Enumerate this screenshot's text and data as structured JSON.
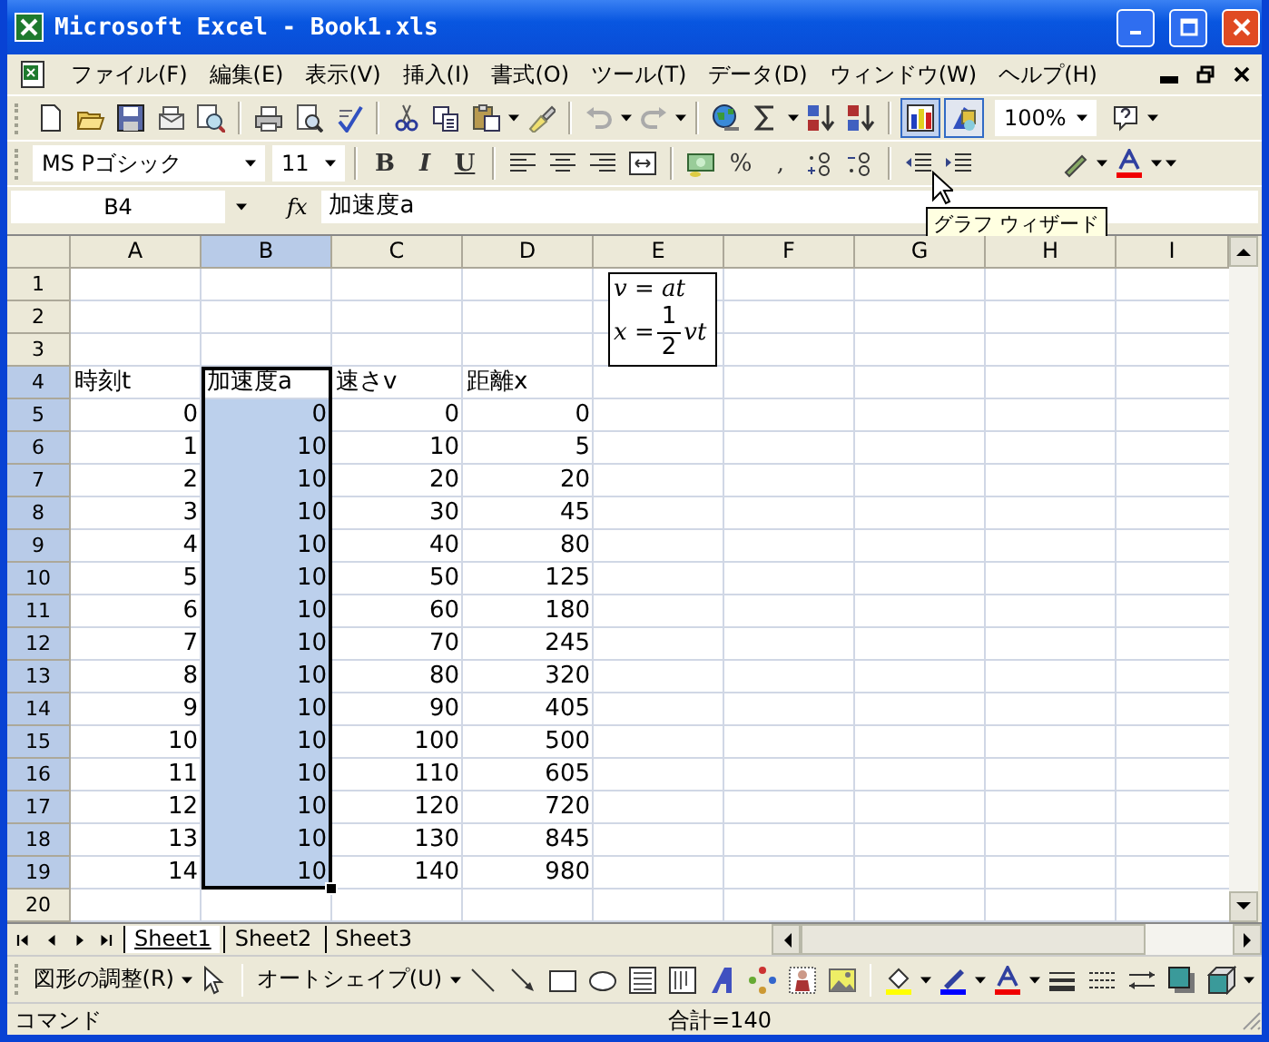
{
  "window": {
    "title": "Microsoft Excel - Book1.xls"
  },
  "menu": [
    "ファイル(F)",
    "編集(E)",
    "表示(V)",
    "挿入(I)",
    "書式(O)",
    "ツール(T)",
    "データ(D)",
    "ウィンドウ(W)",
    "ヘルプ(H)"
  ],
  "standard_toolbar": {
    "chart_wizard_hovered": true,
    "drawing_on": true,
    "zoom": "100%"
  },
  "tooltip": "グラフ ウィザード",
  "formatting_toolbar": {
    "font": "MS Pゴシック",
    "size": "11",
    "style_buttons": [
      "B",
      "I",
      "U"
    ],
    "percent": "%",
    "comma": ","
  },
  "formula_bar": {
    "name_box": "B4",
    "fx": "fx",
    "content": "加速度a"
  },
  "sheet": {
    "columns": [
      {
        "label": "A",
        "selected": false
      },
      {
        "label": "B",
        "selected": true
      },
      {
        "label": "C",
        "selected": false
      },
      {
        "label": "D",
        "selected": false
      },
      {
        "label": "E",
        "selected": false
      },
      {
        "label": "F",
        "selected": false
      },
      {
        "label": "G",
        "selected": false
      },
      {
        "label": "H",
        "selected": false
      },
      {
        "label": "I",
        "selected": false
      }
    ],
    "rows": [
      {
        "header": "1",
        "selected": false,
        "active": false
      },
      {
        "header": "2",
        "selected": false,
        "active": false
      },
      {
        "header": "3",
        "selected": false,
        "active": false
      },
      {
        "header": "4",
        "kind": "label",
        "selected": true,
        "active": true,
        "cells": [
          "時刻t",
          "加速度a",
          "速さv",
          "距離x"
        ]
      },
      {
        "header": "5",
        "kind": "number",
        "selected": true,
        "active": false,
        "cells": [
          "0",
          "0",
          "0",
          "0"
        ]
      },
      {
        "header": "6",
        "kind": "number",
        "selected": true,
        "active": false,
        "cells": [
          "1",
          "10",
          "10",
          "5"
        ]
      },
      {
        "header": "7",
        "kind": "number",
        "selected": true,
        "active": false,
        "cells": [
          "2",
          "10",
          "20",
          "20"
        ]
      },
      {
        "header": "8",
        "kind": "number",
        "selected": true,
        "active": false,
        "cells": [
          "3",
          "10",
          "30",
          "45"
        ]
      },
      {
        "header": "9",
        "kind": "number",
        "selected": true,
        "active": false,
        "cells": [
          "4",
          "10",
          "40",
          "80"
        ]
      },
      {
        "header": "10",
        "kind": "number",
        "selected": true,
        "active": false,
        "cells": [
          "5",
          "10",
          "50",
          "125"
        ]
      },
      {
        "header": "11",
        "kind": "number",
        "selected": true,
        "active": false,
        "cells": [
          "6",
          "10",
          "60",
          "180"
        ]
      },
      {
        "header": "12",
        "kind": "number",
        "selected": true,
        "active": false,
        "cells": [
          "7",
          "10",
          "70",
          "245"
        ]
      },
      {
        "header": "13",
        "kind": "number",
        "selected": true,
        "active": false,
        "cells": [
          "8",
          "10",
          "80",
          "320"
        ]
      },
      {
        "header": "14",
        "kind": "number",
        "selected": true,
        "active": false,
        "cells": [
          "9",
          "10",
          "90",
          "405"
        ]
      },
      {
        "header": "15",
        "kind": "number",
        "selected": true,
        "active": false,
        "cells": [
          "10",
          "10",
          "100",
          "500"
        ]
      },
      {
        "header": "16",
        "kind": "number",
        "selected": true,
        "active": false,
        "cells": [
          "11",
          "10",
          "110",
          "605"
        ]
      },
      {
        "header": "17",
        "kind": "number",
        "selected": true,
        "active": false,
        "cells": [
          "12",
          "10",
          "120",
          "720"
        ]
      },
      {
        "header": "18",
        "kind": "number",
        "selected": true,
        "active": false,
        "cells": [
          "13",
          "10",
          "130",
          "845"
        ]
      },
      {
        "header": "19",
        "kind": "number",
        "selected": true,
        "active": false,
        "cells": [
          "14",
          "10",
          "140",
          "980"
        ]
      },
      {
        "header": "20",
        "selected": false,
        "active": false
      }
    ]
  },
  "equation": {
    "velocity": "v = at",
    "distance_lhs": "x =",
    "numerator": "1",
    "denominator": "2",
    "distance_rhs": "vt"
  },
  "sheet_tabs": [
    {
      "label": "Sheet1",
      "selected": true
    },
    {
      "label": "Sheet2",
      "selected": false
    },
    {
      "label": "Sheet3",
      "selected": false
    }
  ],
  "drawing_toolbar": {
    "arrange": "図形の調整(R)",
    "autoshapes": "オートシェイプ(U)"
  },
  "status_bar": {
    "mode": "コマンド",
    "sum": "合計=140"
  }
}
